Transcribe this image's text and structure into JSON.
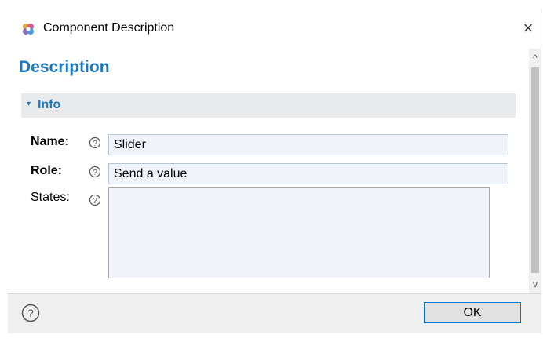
{
  "window": {
    "title": "Component Description",
    "close_symbol": "×",
    "icon": "app-logo-icon"
  },
  "page": {
    "heading": "Description"
  },
  "section": {
    "arrow": "▾",
    "label": "Info"
  },
  "fields": {
    "name": {
      "label": "Name:",
      "value": "Slider"
    },
    "role": {
      "label": "Role:",
      "value": "Send a value"
    },
    "states": {
      "label": "States:",
      "value": ""
    }
  },
  "scrollbar": {
    "up_symbol": "^",
    "down_symbol": "v"
  },
  "footer": {
    "ok_label": "OK"
  },
  "colors": {
    "accent": "#1a78c2",
    "field_bg": "#f0f4fa",
    "section_bg": "#e9eaeb",
    "footer_bg": "#f0f0f0",
    "button_border": "#0078d7"
  }
}
